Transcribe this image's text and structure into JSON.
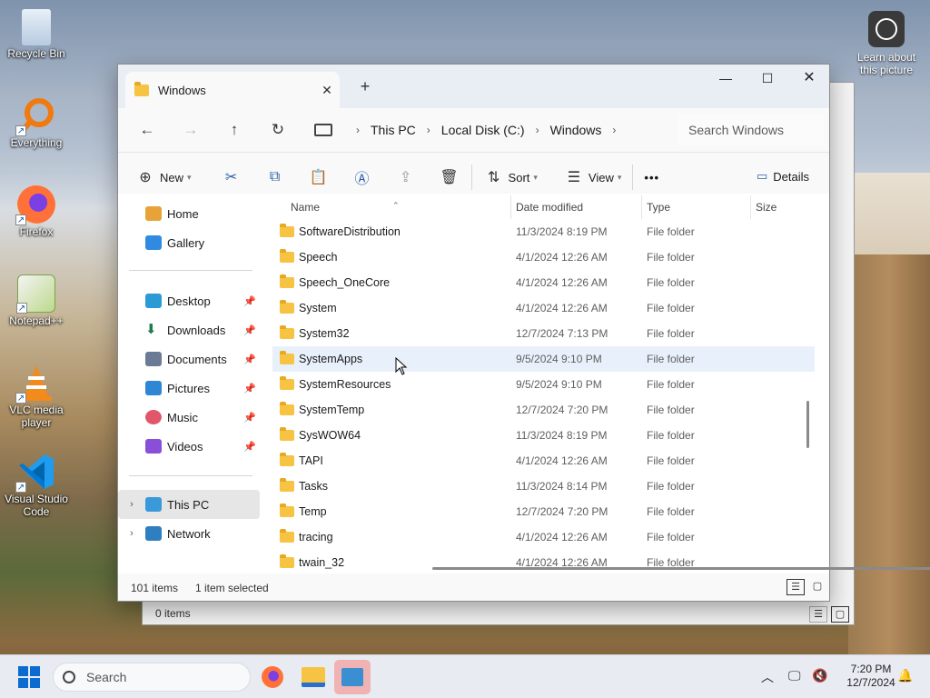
{
  "desktop": {
    "icons": [
      {
        "label": "Recycle Bin"
      },
      {
        "label": "Everything"
      },
      {
        "label": "Firefox"
      },
      {
        "label": "Notepad++"
      },
      {
        "label": "VLC media player"
      },
      {
        "label": "Visual Studio Code"
      }
    ],
    "learn": "Learn about this picture"
  },
  "window": {
    "tab_title": "Windows",
    "tab_close": "✕",
    "new_tab": "+",
    "minimize": "—",
    "maximize": "☐",
    "close": "✕",
    "breadcrumb": [
      "This PC",
      "Local Disk (C:)",
      "Windows"
    ],
    "search_placeholder": "Search Windows",
    "toolbar": {
      "new": "New",
      "sort": "Sort",
      "view": "View",
      "more": "•••",
      "details": "Details"
    },
    "nav": {
      "home": "Home",
      "gallery": "Gallery",
      "desktop": "Desktop",
      "downloads": "Downloads",
      "documents": "Documents",
      "pictures": "Pictures",
      "music": "Music",
      "videos": "Videos",
      "this_pc": "This PC",
      "network": "Network"
    },
    "columns": {
      "name": "Name",
      "date": "Date modified",
      "type": "Type",
      "size": "Size"
    },
    "files": [
      {
        "name": "SoftwareDistribution",
        "date": "11/3/2024 8:19 PM",
        "type": "File folder"
      },
      {
        "name": "Speech",
        "date": "4/1/2024 12:26 AM",
        "type": "File folder"
      },
      {
        "name": "Speech_OneCore",
        "date": "4/1/2024 12:26 AM",
        "type": "File folder"
      },
      {
        "name": "System",
        "date": "4/1/2024 12:26 AM",
        "type": "File folder"
      },
      {
        "name": "System32",
        "date": "12/7/2024 7:13 PM",
        "type": "File folder"
      },
      {
        "name": "SystemApps",
        "date": "9/5/2024 9:10 PM",
        "type": "File folder"
      },
      {
        "name": "SystemResources",
        "date": "9/5/2024 9:10 PM",
        "type": "File folder"
      },
      {
        "name": "SystemTemp",
        "date": "12/7/2024 7:20 PM",
        "type": "File folder"
      },
      {
        "name": "SysWOW64",
        "date": "11/3/2024 8:19 PM",
        "type": "File folder"
      },
      {
        "name": "TAPI",
        "date": "4/1/2024 12:26 AM",
        "type": "File folder"
      },
      {
        "name": "Tasks",
        "date": "11/3/2024 8:14 PM",
        "type": "File folder"
      },
      {
        "name": "Temp",
        "date": "12/7/2024 7:20 PM",
        "type": "File folder"
      },
      {
        "name": "tracing",
        "date": "4/1/2024 12:26 AM",
        "type": "File folder"
      },
      {
        "name": "twain_32",
        "date": "4/1/2024 12:26 AM",
        "type": "File folder"
      }
    ],
    "status": {
      "count": "101 items",
      "selected": "1 item selected"
    }
  },
  "back_window": {
    "status": "0 items"
  },
  "taskbar": {
    "search": "Search",
    "time": "7:20 PM",
    "date": "12/7/2024"
  },
  "colors": {
    "accent": "#0a6cd0",
    "folder": "#f6c342",
    "hover_row": "#e8f1fb"
  }
}
